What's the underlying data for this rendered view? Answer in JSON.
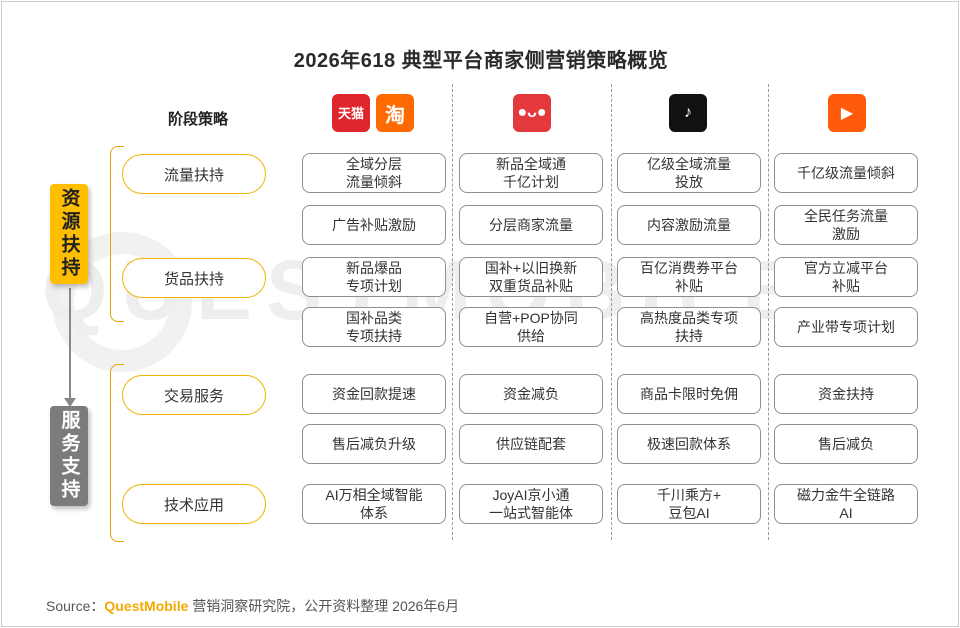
{
  "title": "2026年618 典型平台商家侧营销策略概览",
  "watermark": "QUESTMOBILE",
  "stage_header": "阶段策略",
  "platforms": [
    {
      "name": "tmall-taobao",
      "tiles": [
        {
          "glyph": "天猫",
          "icon": "tmall-icon"
        },
        {
          "glyph": "淘",
          "icon": "taobao-icon"
        }
      ]
    },
    {
      "name": "jd",
      "tiles": [
        {
          "glyph": "●ᴗ●",
          "icon": "jd-icon"
        }
      ]
    },
    {
      "name": "douyin",
      "tiles": [
        {
          "glyph": "♪",
          "icon": "douyin-icon"
        }
      ]
    },
    {
      "name": "kuaishou",
      "tiles": [
        {
          "glyph": "▶",
          "icon": "kuaishou-icon"
        }
      ]
    }
  ],
  "groups": [
    {
      "label": "资源扶持",
      "color": "#ffbf00"
    },
    {
      "label": "服务支持",
      "color": "#7c7c7c"
    }
  ],
  "stages": [
    "流量扶持",
    "货品扶持",
    "交易服务",
    "技术应用"
  ],
  "rows": [
    [
      "全域分层\n流量倾斜",
      "新品全域通\n千亿计划",
      "亿级全域流量\n投放",
      "千亿级流量倾斜"
    ],
    [
      "广告补贴激励",
      "分层商家流量",
      "内容激励流量",
      "全民任务流量\n激励"
    ],
    [
      "新品爆品\n专项计划",
      "国补+以旧换新\n双重货品补贴",
      "百亿消费券平台\n补贴",
      "官方立减平台\n补贴"
    ],
    [
      "国补品类\n专项扶持",
      "自营+POP协同\n供给",
      "高热度品类专项\n扶持",
      "产业带专项计划"
    ],
    [
      "资金回款提速",
      "资金减负",
      "商品卡限时免佣",
      "资金扶持"
    ],
    [
      "售后减负升级",
      "供应链配套",
      "极速回款体系",
      "售后减负"
    ],
    [
      "AI万相全域智能\n体系",
      "JoyAI京小通\n一站式智能体",
      "千川乘方+\n豆包AI",
      "磁力金牛全链路\nAI"
    ]
  ],
  "source": {
    "prefix": "Source：",
    "brand": "QuestMobile",
    "suffix": " 营销洞察研究院，公开资料整理 2026年6月"
  },
  "colors": {
    "accent": "#ffbf00",
    "gray_group": "#7c7c7c",
    "brand": "#f5a800"
  }
}
